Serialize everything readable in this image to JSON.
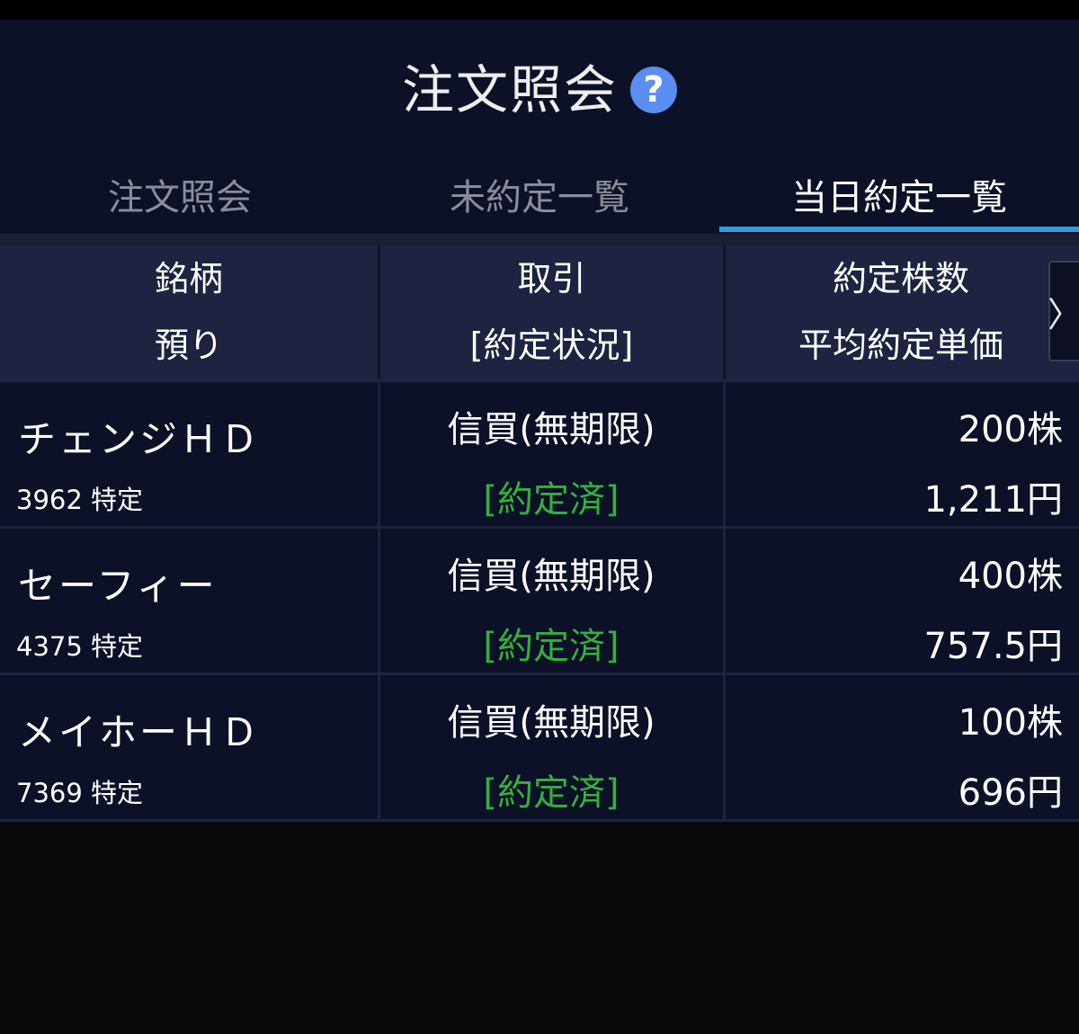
{
  "header": {
    "title": "注文照会",
    "help_icon": "question-circle-icon"
  },
  "tabs": [
    {
      "label": "注文照会",
      "active": false
    },
    {
      "label": "未約定一覧",
      "active": false
    },
    {
      "label": "当日約定一覧",
      "active": true
    }
  ],
  "columns": {
    "col1": {
      "line1": "銘柄",
      "line2": "預り"
    },
    "col2": {
      "line1": "取引",
      "line2": "[約定状況]"
    },
    "col3": {
      "line1": "約定株数",
      "line2": "平均約定単価"
    },
    "scroll_glyph": "〉"
  },
  "rows": [
    {
      "name": "チェンジＨＤ",
      "code": "3962 特定",
      "trade": "信買(無期限)",
      "status": "[約定済]",
      "qty": "200株",
      "price": "1,211円"
    },
    {
      "name": "セーフィー",
      "code": "4375 特定",
      "trade": "信買(無期限)",
      "status": "[約定済]",
      "qty": "400株",
      "price": "757.5円"
    },
    {
      "name": "メイホーＨＤ",
      "code": "7369 特定",
      "trade": "信買(無期限)",
      "status": "[約定済]",
      "qty": "100株",
      "price": "696円"
    }
  ],
  "colors": {
    "background": "#0d1128",
    "header_row": "#1d2340",
    "tab_indicator": "#2e9fe6",
    "status_green": "#31b13c",
    "help_icon": "#5a8ef0"
  }
}
